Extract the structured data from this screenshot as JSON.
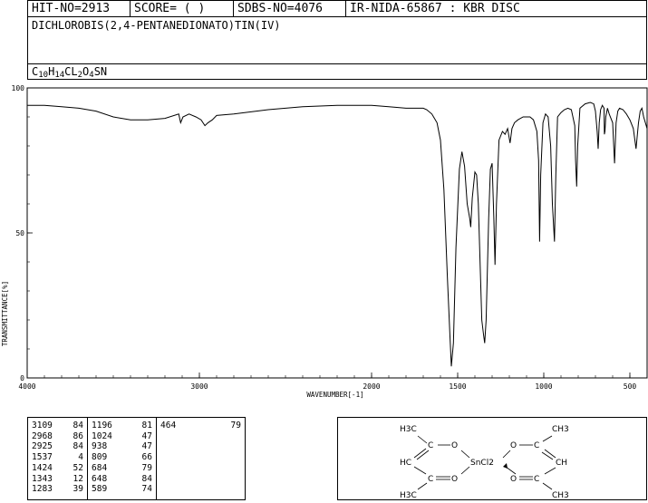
{
  "header": {
    "hit_no": "HIT-NO=2913",
    "score": "SCORE=  (   )",
    "sdbs_no": "SDBS-NO=4076",
    "ir_id": "IR-NIDA-65867 : KBR DISC"
  },
  "compound": {
    "name": "DICHLOROBIS(2,4-PENTANEDIONATO)TIN(IV)",
    "formula_parts": [
      {
        "t": "C",
        "sub": false
      },
      {
        "t": "10",
        "sub": true
      },
      {
        "t": "H",
        "sub": false
      },
      {
        "t": "14",
        "sub": true
      },
      {
        "t": "CL",
        "sub": false
      },
      {
        "t": "2",
        "sub": true
      },
      {
        "t": "O",
        "sub": false
      },
      {
        "t": "4",
        "sub": true
      },
      {
        "t": "SN",
        "sub": false
      }
    ]
  },
  "chart_data": {
    "type": "line",
    "xlabel": "WAVENUMBER[-1]",
    "ylabel": "TRANSMITTANCE[%]",
    "xlim": [
      4000,
      400
    ],
    "ylim": [
      0,
      100
    ],
    "x_ticks": [
      4000,
      3000,
      2000,
      1500,
      1000,
      500
    ],
    "y_ticks": [
      0,
      50,
      100
    ],
    "series": [
      {
        "x": [
          4000,
          3900,
          3800,
          3700,
          3600,
          3500,
          3400,
          3300,
          3200,
          3120,
          3109,
          3095,
          3060,
          3020,
          2990,
          2968,
          2950,
          2925,
          2900,
          2800,
          2600,
          2400,
          2200,
          2000,
          1900,
          1800,
          1750,
          1700,
          1680,
          1650,
          1620,
          1600,
          1580,
          1560,
          1545,
          1537,
          1525,
          1510,
          1490,
          1475,
          1460,
          1445,
          1430,
          1424,
          1415,
          1400,
          1390,
          1380,
          1370,
          1360,
          1350,
          1343,
          1335,
          1320,
          1310,
          1300,
          1290,
          1283,
          1275,
          1260,
          1240,
          1225,
          1210,
          1196,
          1185,
          1170,
          1150,
          1120,
          1100,
          1080,
          1060,
          1040,
          1030,
          1024,
          1018,
          1005,
          990,
          975,
          960,
          950,
          938,
          930,
          920,
          900,
          880,
          860,
          840,
          820,
          815,
          809,
          803,
          790,
          760,
          730,
          710,
          700,
          690,
          684,
          678,
          670,
          660,
          650,
          648,
          645,
          640,
          630,
          620,
          600,
          589,
          580,
          570,
          560,
          540,
          520,
          500,
          480,
          464,
          455,
          450,
          440,
          430,
          420,
          400
        ],
        "y": [
          94,
          94,
          93.5,
          93,
          92,
          90,
          89,
          89,
          89.5,
          91,
          88,
          90,
          91,
          90,
          89,
          87,
          88,
          89,
          90.5,
          91,
          92.5,
          93.5,
          94,
          94,
          93.5,
          93,
          93,
          93,
          92.5,
          91,
          88,
          82,
          65,
          35,
          15,
          4,
          12,
          45,
          72,
          78,
          73,
          60,
          55,
          52,
          62,
          71,
          70,
          60,
          40,
          20,
          15,
          12,
          20,
          55,
          72,
          74,
          55,
          39,
          60,
          82,
          85,
          84,
          86,
          81,
          86,
          88,
          89,
          90,
          90,
          90,
          89,
          85,
          75,
          47,
          70,
          88,
          91,
          90,
          80,
          60,
          47,
          70,
          90,
          91.5,
          92.5,
          93,
          92.5,
          87,
          75,
          66,
          80,
          93,
          94.5,
          95,
          94.5,
          92,
          85,
          79,
          88,
          92.5,
          94,
          93,
          84,
          85,
          90,
          93,
          91,
          88,
          74,
          88,
          92,
          93,
          92.5,
          91,
          89,
          86,
          79,
          85,
          88,
          92,
          93,
          90,
          86
        ]
      }
    ]
  },
  "peaks": [
    [
      [
        "3109",
        "84"
      ],
      [
        "2968",
        "86"
      ],
      [
        "2925",
        "84"
      ],
      [
        "1537",
        "4"
      ],
      [
        "1424",
        "52"
      ],
      [
        "1343",
        "12"
      ],
      [
        "1283",
        "39"
      ]
    ],
    [
      [
        "1196",
        "81"
      ],
      [
        "1024",
        "47"
      ],
      [
        "938",
        "47"
      ],
      [
        "809",
        "66"
      ],
      [
        "684",
        "79"
      ],
      [
        "648",
        "84"
      ],
      [
        "589",
        "74"
      ]
    ],
    [
      [
        "464",
        "79"
      ]
    ]
  ],
  "structure": {
    "labels": {
      "me_tl": "H3C",
      "c_tl": "C",
      "o_tr": "O",
      "hc": "HC",
      "c_bl": "C",
      "o_br": "O",
      "me_bl": "H3C",
      "sn": "SnCl2",
      "o_tl2": "O",
      "c_tr2": "C",
      "me_tr": "CH3",
      "ch": "CH",
      "o_bl2": "O",
      "c_br2": "C",
      "me_br": "CH3"
    }
  }
}
